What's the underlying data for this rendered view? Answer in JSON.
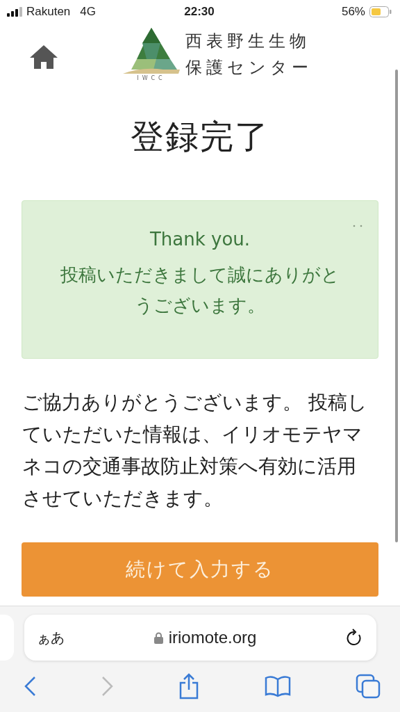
{
  "status_bar": {
    "carrier": "Rakuten",
    "network": "4G",
    "time": "22:30",
    "battery": "56%"
  },
  "header": {
    "logo_caption": "IWCC",
    "logo_lines": [
      "西表野生生物",
      "保護センター"
    ]
  },
  "title": "登録完了",
  "alert": {
    "heading": "Thank you.",
    "message": "投稿いただきまして誠にありがとうございます。"
  },
  "body": "ご協力ありがとうございます。 投稿していただいた情報は、イリオモテヤマネコの交通事故防止対策へ有効に活用させていただきます。",
  "continue_button": "続けて入力する",
  "browser": {
    "text_size": "ぁあ",
    "url": "iriomote.org",
    "back": {
      "disabled": false
    },
    "forward": {
      "disabled": true
    }
  }
}
